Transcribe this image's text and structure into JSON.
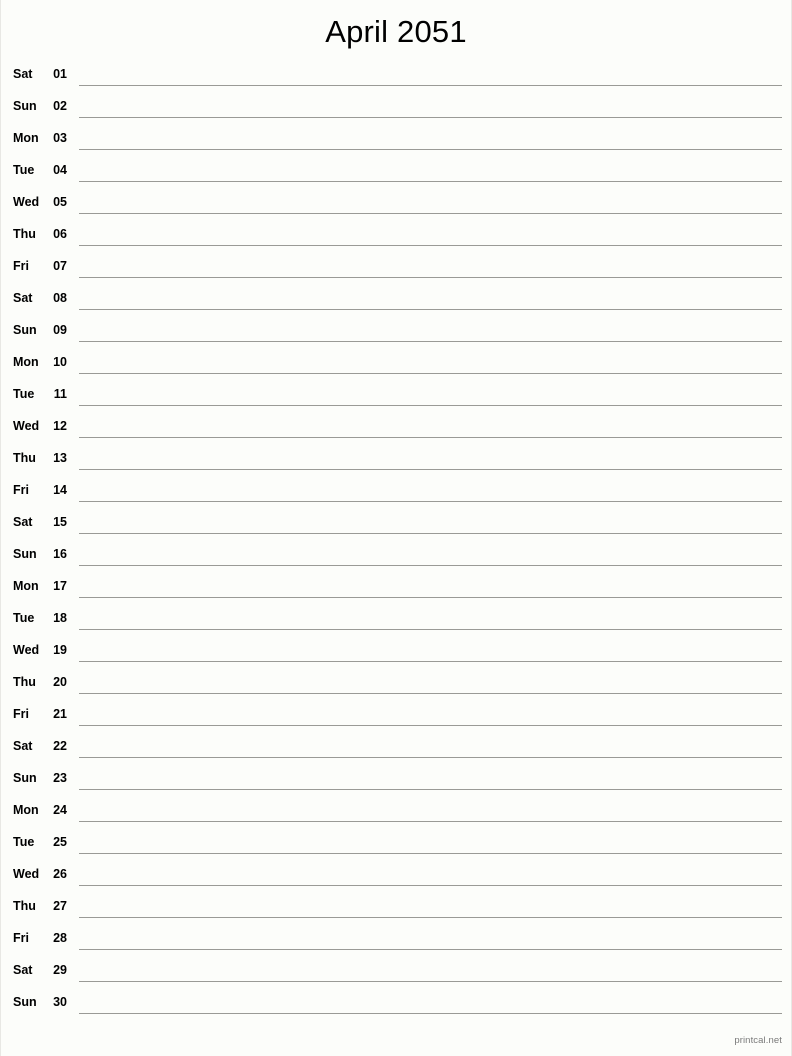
{
  "document": {
    "title": "April 2051",
    "month": "April",
    "year": "2051",
    "background_color": "#fcfdfa",
    "rule_color": "#9a9a96",
    "text_color": "#000000"
  },
  "footer": {
    "label": "printcal.net",
    "color": "#7a7a7a"
  },
  "calendar": {
    "days": [
      {
        "weekday": "Sat",
        "number": "01"
      },
      {
        "weekday": "Sun",
        "number": "02"
      },
      {
        "weekday": "Mon",
        "number": "03"
      },
      {
        "weekday": "Tue",
        "number": "04"
      },
      {
        "weekday": "Wed",
        "number": "05"
      },
      {
        "weekday": "Thu",
        "number": "06"
      },
      {
        "weekday": "Fri",
        "number": "07"
      },
      {
        "weekday": "Sat",
        "number": "08"
      },
      {
        "weekday": "Sun",
        "number": "09"
      },
      {
        "weekday": "Mon",
        "number": "10"
      },
      {
        "weekday": "Tue",
        "number": "11"
      },
      {
        "weekday": "Wed",
        "number": "12"
      },
      {
        "weekday": "Thu",
        "number": "13"
      },
      {
        "weekday": "Fri",
        "number": "14"
      },
      {
        "weekday": "Sat",
        "number": "15"
      },
      {
        "weekday": "Sun",
        "number": "16"
      },
      {
        "weekday": "Mon",
        "number": "17"
      },
      {
        "weekday": "Tue",
        "number": "18"
      },
      {
        "weekday": "Wed",
        "number": "19"
      },
      {
        "weekday": "Thu",
        "number": "20"
      },
      {
        "weekday": "Fri",
        "number": "21"
      },
      {
        "weekday": "Sat",
        "number": "22"
      },
      {
        "weekday": "Sun",
        "number": "23"
      },
      {
        "weekday": "Mon",
        "number": "24"
      },
      {
        "weekday": "Tue",
        "number": "25"
      },
      {
        "weekday": "Wed",
        "number": "26"
      },
      {
        "weekday": "Thu",
        "number": "27"
      },
      {
        "weekday": "Fri",
        "number": "28"
      },
      {
        "weekday": "Sat",
        "number": "29"
      },
      {
        "weekday": "Sun",
        "number": "30"
      }
    ]
  }
}
